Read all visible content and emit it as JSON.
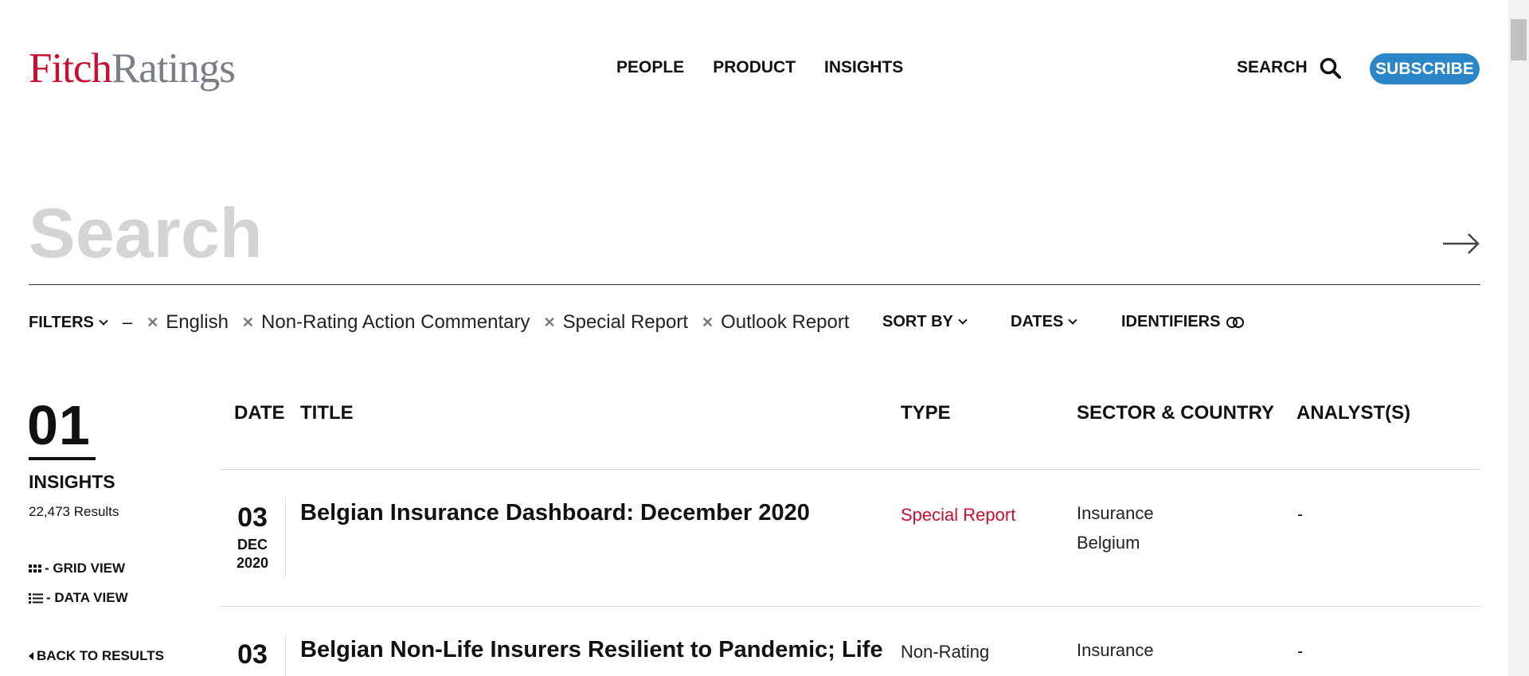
{
  "header": {
    "logo_part1": "Fitch",
    "logo_part2": "Ratings",
    "nav": [
      "PEOPLE",
      "PRODUCT",
      "INSIGHTS"
    ],
    "search_label": "SEARCH",
    "subscribe_label": "SUBSCRIBE"
  },
  "search": {
    "placeholder": "Search"
  },
  "filters": {
    "label": "FILTERS",
    "dash": "–",
    "chips": [
      "English",
      "Non-Rating Action Commentary",
      "Special Report",
      "Outlook Report"
    ],
    "sort_by": "SORT BY",
    "dates": "DATES",
    "identifiers": "IDENTIFIERS"
  },
  "summary": {
    "count": "01",
    "label": "INSIGHTS",
    "results": "22,473 Results",
    "grid_view": "- GRID VIEW",
    "data_view": "- DATA VIEW",
    "back": "BACK TO RESULTS"
  },
  "table": {
    "headers": {
      "date": "DATE",
      "title": "TITLE",
      "type": "TYPE",
      "sector": "SECTOR & COUNTRY",
      "analyst": "ANALYST(S)"
    },
    "rows": [
      {
        "day": "03",
        "month": "DEC",
        "year": "2020",
        "title": "Belgian Insurance Dashboard: December 2020",
        "type": "Special Report",
        "sector": "Insurance",
        "country": "Belgium",
        "analyst": "-"
      },
      {
        "day": "03",
        "title": "Belgian Non-Life Insurers Resilient to Pandemic; Life",
        "type": "Non-Rating",
        "sector": "Insurance",
        "analyst": "-"
      }
    ]
  },
  "colors": {
    "brand_red": "#c8102e",
    "subscribe_blue": "#2a86c7"
  }
}
